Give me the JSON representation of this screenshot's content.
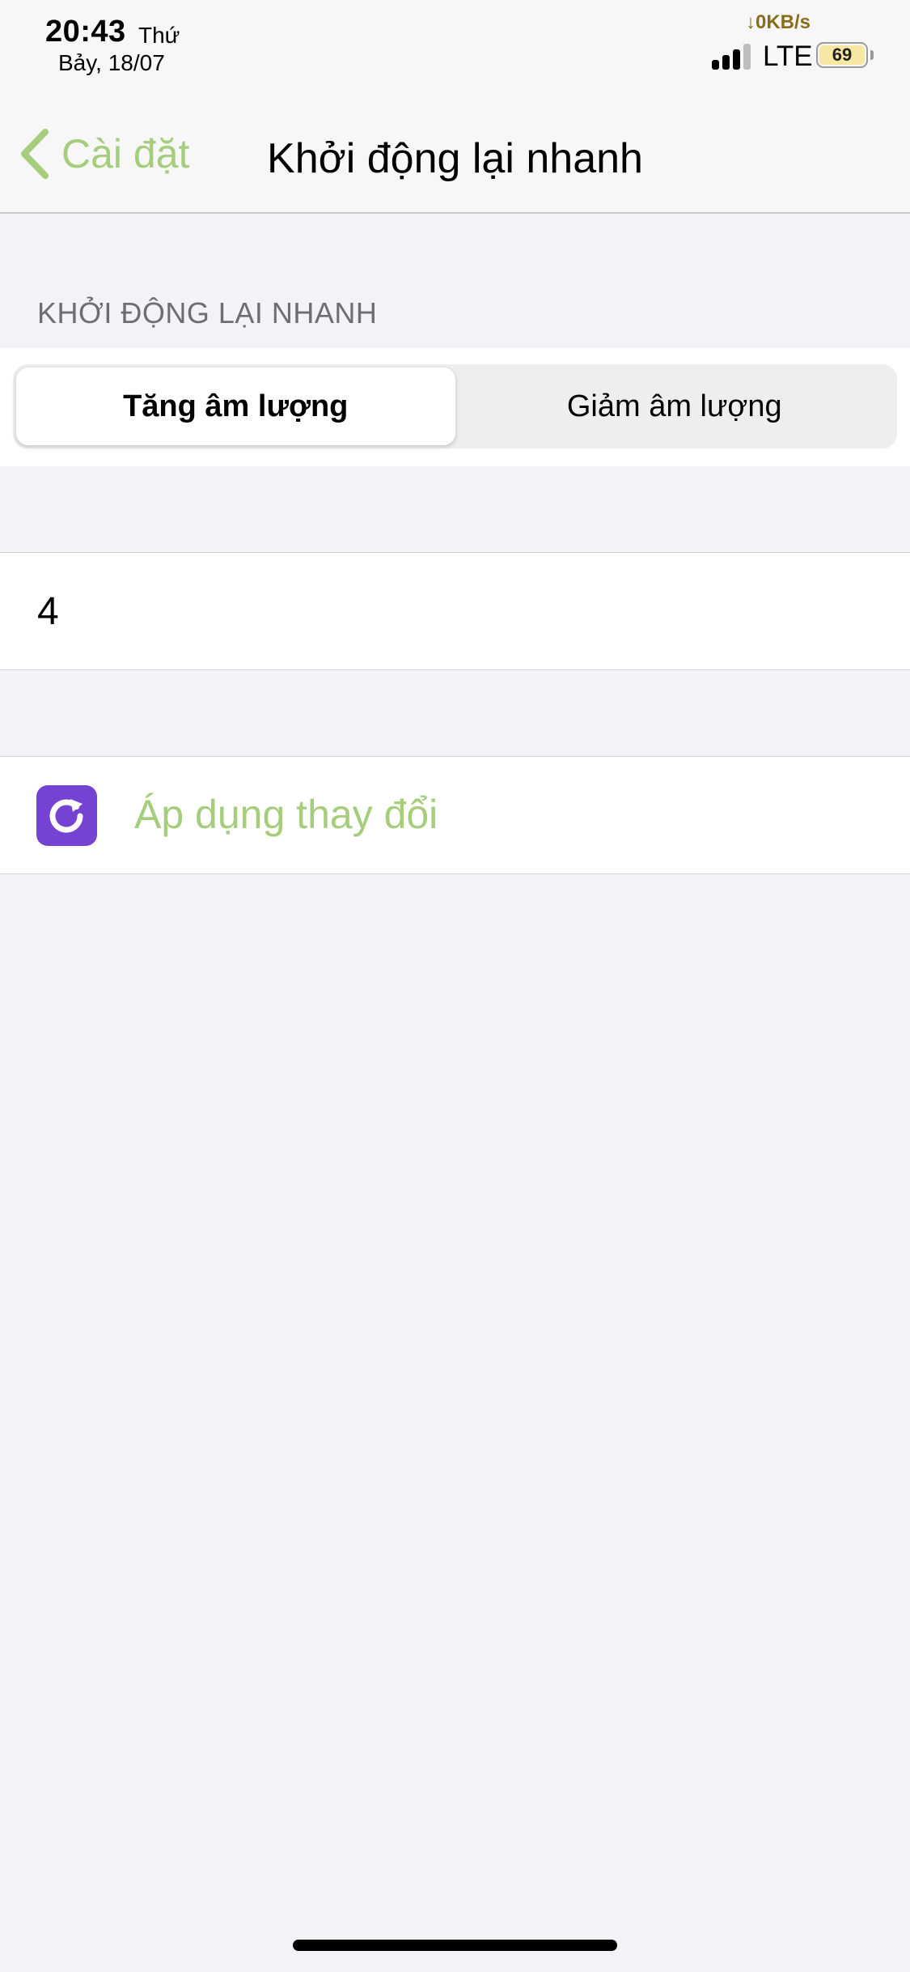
{
  "status_bar": {
    "time": "20:43",
    "day": "Thứ",
    "date": "Bảy, 18/07",
    "net_speed": "↓0KB/s",
    "network": "LTE",
    "battery": "69",
    "signal_bars_active": 3,
    "signal_bars_total": 4
  },
  "nav": {
    "back_label": "Cài đặt",
    "title": "Khởi động lại nhanh"
  },
  "section": {
    "header": "KHỞI ĐỘNG LẠI NHANH"
  },
  "segmented": {
    "options": [
      "Tăng âm lượng",
      "Giảm âm lượng"
    ],
    "selected": "Tăng âm lượng"
  },
  "value_row": {
    "value": "4"
  },
  "apply": {
    "label": "Áp dụng thay đổi",
    "icon": "refresh-icon"
  },
  "colors": {
    "accent": "#a5cd7b",
    "icon_bg": "#7443d2",
    "background": "#f2f2f7",
    "net_speed": "#8a6d1a",
    "battery_fill": "#f6e7a3"
  }
}
